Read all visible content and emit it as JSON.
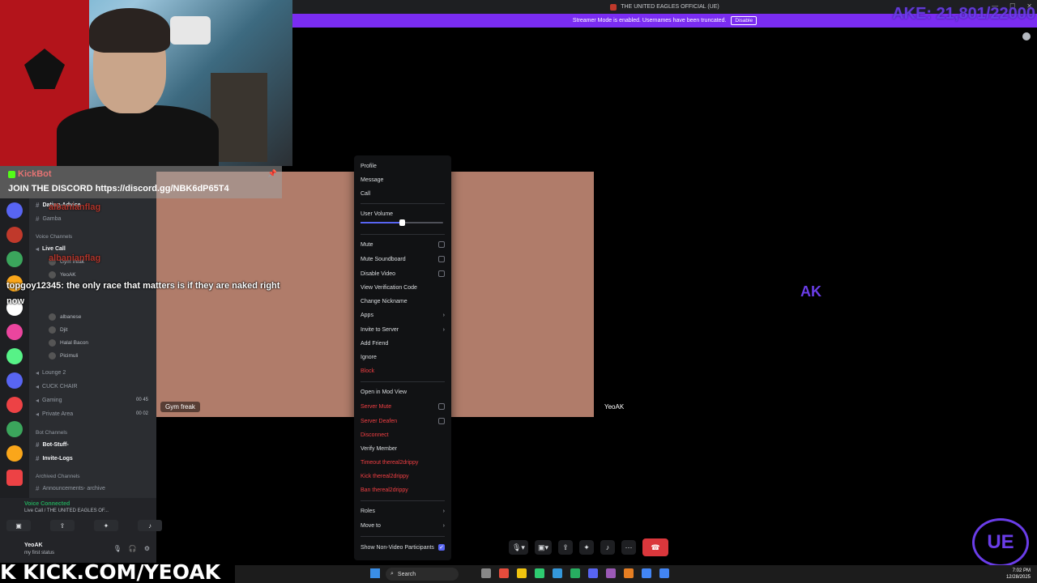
{
  "window": {
    "title": "THE UNITED EAGLES OFFICIAL (UE)",
    "streamer_banner": "Streamer Mode is enabled. Usernames have been truncated.",
    "streamer_disable": "Disable"
  },
  "overlay": {
    "counter": "AKE: 21,801/22000",
    "kickbot_name": "KickBot",
    "kickbot_msg": "JOIN THE DISCORD https://discord.gg/NBK6dP65T4",
    "chat_user1": "albanianflag",
    "chat_user2": "albanianflag",
    "chat_line": "topgoy12345: the only race that matters is if they are naked right now",
    "kick_label": "K KICK.COM/YEOAK"
  },
  "sidebar": {
    "channels": [
      {
        "name": "Dating-Advice"
      },
      {
        "name": "Gamba"
      },
      {
        "name": "Live Call"
      },
      {
        "name": "Lounge 2"
      },
      {
        "name": "CUCK CHAIR"
      },
      {
        "name": "Gaming"
      },
      {
        "name": "Private Area"
      }
    ],
    "categories": {
      "voice": "Voice Channels",
      "bot": "Bot Channels",
      "archived": "Archived Channels"
    },
    "bot_channels": [
      "Bot-Stuff-",
      "Invite-Logs"
    ],
    "archived_channel": "Announcements- archive",
    "users": [
      "Gym freak",
      "YeoAK",
      "albanese",
      "Djit",
      "Halal Bacon",
      "Picimuli"
    ],
    "gaming_counts": "00  45",
    "private_counts": "00  02",
    "voice_connected": "Voice Connected",
    "voice_sub": "Live Call / THE UNITED EAGLES OF...",
    "username": "YeoAK",
    "user_status": "my first status"
  },
  "call": {
    "tile_left_name": "Gym freak",
    "tile_right_name": "YeoAK",
    "avatar_text": "AK"
  },
  "menu": {
    "profile": "Profile",
    "message": "Message",
    "call": "Call",
    "user_volume": "User Volume",
    "volume_level": 0.5,
    "mute": "Mute",
    "mute_soundboard": "Mute Soundboard",
    "disable_video": "Disable Video",
    "view_verification": "View Verification Code",
    "change_nickname": "Change Nickname",
    "apps": "Apps",
    "invite": "Invite to Server",
    "add_friend": "Add Friend",
    "ignore": "Ignore",
    "block": "Block",
    "mod_view": "Open in Mod View",
    "server_mute": "Server Mute",
    "server_deafen": "Server Deafen",
    "disconnect": "Disconnect",
    "verify_member": "Verify Member",
    "timeout": "Timeout thereal2drippy",
    "kick": "Kick thereal2drippy",
    "ban": "Ban thereal2drippy",
    "roles": "Roles",
    "move_to": "Move to",
    "show_non_video": "Show Non-Video Participants"
  },
  "taskbar": {
    "search": "Search",
    "time": "7:02 PM",
    "date": "12/28/2025"
  },
  "logo_text": "UE"
}
